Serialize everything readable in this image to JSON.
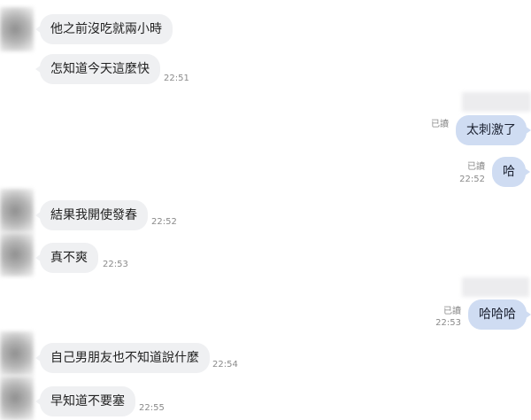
{
  "colors": {
    "incoming_bubble": "#eff0f2",
    "outgoing_bubble": "#cfdcf2",
    "meta_text": "#8a8a8a"
  },
  "messages": [
    {
      "side": "in",
      "text": "他之前沒吃就兩小時",
      "time": ""
    },
    {
      "side": "in",
      "text": "怎知道今天這麼快",
      "time": "22:51"
    },
    {
      "side": "out",
      "text": "太刺激了",
      "read": "已讀",
      "time": ""
    },
    {
      "side": "out",
      "text": "哈",
      "read": "已讀",
      "time": "22:52"
    },
    {
      "side": "in",
      "text": "結果我開使發春",
      "time": "22:52"
    },
    {
      "side": "in",
      "text": "真不爽",
      "time": "22:53"
    },
    {
      "side": "out",
      "text": "哈哈哈",
      "read": "已讀",
      "time": "22:53"
    },
    {
      "side": "in",
      "text": "自己男朋友也不知道說什麼",
      "time": "22:54"
    },
    {
      "side": "in",
      "text": "早知道不要塞",
      "time": "22:55"
    }
  ]
}
